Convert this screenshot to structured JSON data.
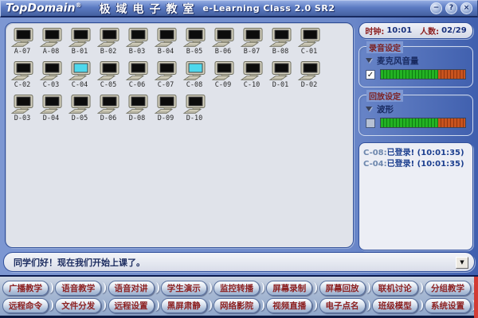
{
  "titlebar": {
    "logo": "TopDomain",
    "reg": "®",
    "title_cn": "极域电子教室",
    "title_en": "e-Learning Class 2.0 SR2",
    "buttons": {
      "minimize": "−",
      "help": "?",
      "close": "×"
    }
  },
  "status": {
    "clock_label": "时钟:",
    "clock_value": "10:01",
    "count_label": "人数:",
    "count_value": "02/29"
  },
  "recording": {
    "group_title": "录音设定",
    "option_label": "麦克风音量",
    "checkbox_checked": true,
    "check_glyph": "✓",
    "meter_green_pct": 68
  },
  "playback": {
    "group_title": "回放设定",
    "option_label": "波形",
    "checkbox_checked": false,
    "check_glyph": "",
    "meter_green_pct": 68
  },
  "log": {
    "entries": [
      {
        "id": "C-08:",
        "text": "已登录! (10:01:35)"
      },
      {
        "id": "C-04:",
        "text": "已登录! (10:01:35)"
      }
    ]
  },
  "message_bar": {
    "text": "同学们好！现在我们开始上课了。",
    "dropdown_glyph": "▼"
  },
  "students": {
    "computers": [
      {
        "id": "A-07",
        "online": false
      },
      {
        "id": "A-08",
        "online": false
      },
      {
        "id": "B-01",
        "online": false
      },
      {
        "id": "B-02",
        "online": false
      },
      {
        "id": "B-03",
        "online": false
      },
      {
        "id": "B-04",
        "online": false
      },
      {
        "id": "B-05",
        "online": false
      },
      {
        "id": "B-06",
        "online": false
      },
      {
        "id": "B-07",
        "online": false
      },
      {
        "id": "B-08",
        "online": false
      },
      {
        "id": "C-01",
        "online": false
      },
      {
        "id": "C-02",
        "online": false
      },
      {
        "id": "C-03",
        "online": false
      },
      {
        "id": "C-04",
        "online": true
      },
      {
        "id": "C-05",
        "online": false
      },
      {
        "id": "C-06",
        "online": false
      },
      {
        "id": "C-07",
        "online": false
      },
      {
        "id": "C-08",
        "online": true
      },
      {
        "id": "C-09",
        "online": false
      },
      {
        "id": "C-10",
        "online": false
      },
      {
        "id": "D-01",
        "online": false
      },
      {
        "id": "D-02",
        "online": false
      },
      {
        "id": "D-03",
        "online": false
      },
      {
        "id": "D-04",
        "online": false
      },
      {
        "id": "D-05",
        "online": false
      },
      {
        "id": "D-06",
        "online": false
      },
      {
        "id": "D-08",
        "online": false
      },
      {
        "id": "D-09",
        "online": false
      },
      {
        "id": "D-10",
        "online": false
      }
    ]
  },
  "toolbar": {
    "row1": [
      "广播教学",
      "语音教学",
      "语音对讲",
      "学生演示",
      "监控转播",
      "屏幕录制",
      "屏幕回放",
      "联机讨论",
      "分组教学"
    ],
    "row2": [
      "远程命令",
      "文件分发",
      "远程设置",
      "黑屏肃静",
      "网络影院",
      "视频直播",
      "电子点名",
      "班级模型",
      "系统设置"
    ]
  },
  "colors": {
    "online_screen": "#4fd8ec",
    "offline_screen": "#0c0c0c",
    "label_maroon": "#8c1f1f",
    "value_navy": "#17307c",
    "meter_green": "#23b223",
    "meter_red": "#c8531e"
  }
}
